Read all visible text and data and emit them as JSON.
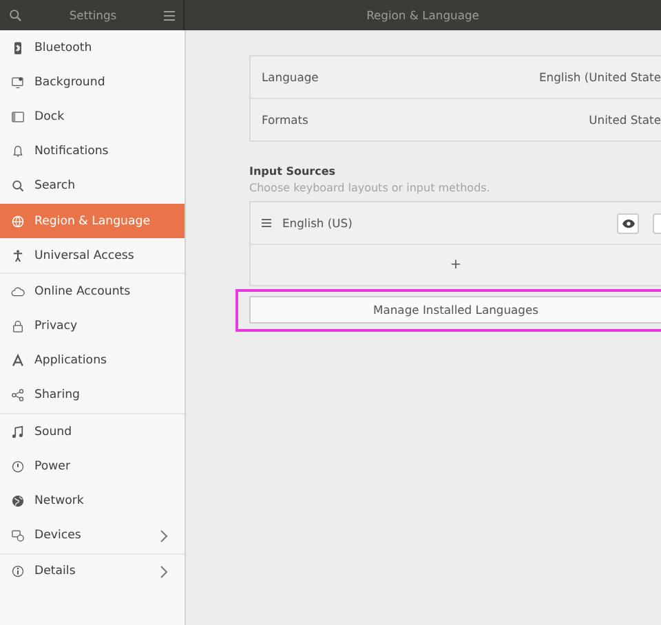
{
  "header": {
    "sidebar_title": "Settings",
    "title": "Region & Language"
  },
  "sidebar": {
    "groups": [
      [
        {
          "label": "Bluetooth",
          "selected": false,
          "has_submenu": false
        },
        {
          "label": "Background",
          "selected": false,
          "has_submenu": false
        },
        {
          "label": "Dock",
          "selected": false,
          "has_submenu": false
        },
        {
          "label": "Notifications",
          "selected": false,
          "has_submenu": false
        },
        {
          "label": "Search",
          "selected": false,
          "has_submenu": false
        },
        {
          "label": "Region & Language",
          "selected": true,
          "has_submenu": false
        },
        {
          "label": "Universal Access",
          "selected": false,
          "has_submenu": false
        }
      ],
      [
        {
          "label": "Online Accounts",
          "selected": false,
          "has_submenu": false
        },
        {
          "label": "Privacy",
          "selected": false,
          "has_submenu": false
        },
        {
          "label": "Applications",
          "selected": false,
          "has_submenu": false
        },
        {
          "label": "Sharing",
          "selected": false,
          "has_submenu": false
        }
      ],
      [
        {
          "label": "Sound",
          "selected": false,
          "has_submenu": false
        },
        {
          "label": "Power",
          "selected": false,
          "has_submenu": false
        },
        {
          "label": "Network",
          "selected": false,
          "has_submenu": false
        },
        {
          "label": "Devices",
          "selected": false,
          "has_submenu": true
        }
      ],
      [
        {
          "label": "Details",
          "selected": false,
          "has_submenu": true
        }
      ]
    ]
  },
  "settings": [
    {
      "label": "Language",
      "value": "English (United State"
    },
    {
      "label": "Formats",
      "value": "United State"
    }
  ],
  "input_sources": {
    "title": "Input Sources",
    "subtitle": "Choose keyboard layouts or input methods.",
    "sources": [
      {
        "name": "English (US)"
      }
    ],
    "add": "+"
  },
  "manage_button": "Manage Installed Languages"
}
